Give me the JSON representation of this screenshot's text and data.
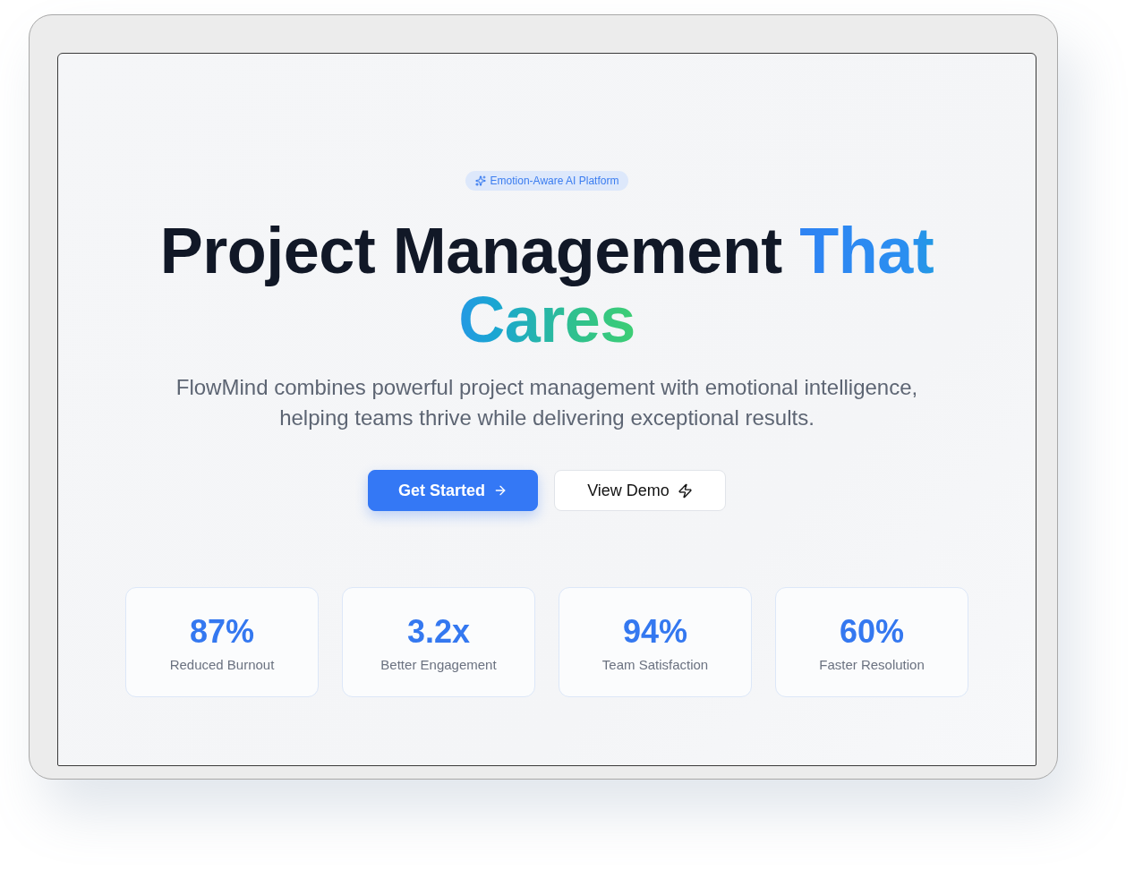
{
  "badge": {
    "label": "Emotion-Aware AI Platform"
  },
  "hero": {
    "heading": "Project Management",
    "heading_accent": "That Cares",
    "subtitle": "FlowMind combines powerful project management with emotional intelligence, helping teams thrive while delivering exceptional results."
  },
  "buttons": [
    {
      "kind": "primary",
      "label": "Get Started"
    },
    {
      "kind": "secondary",
      "label": "View Demo"
    }
  ],
  "stats": [
    {
      "value": "87%",
      "label": "Reduced Burnout"
    },
    {
      "value": "3.2x",
      "label": "Better Engagement"
    },
    {
      "value": "94%",
      "label": "Team Satisfaction"
    },
    {
      "value": "60%",
      "label": "Faster Resolution"
    }
  ]
}
